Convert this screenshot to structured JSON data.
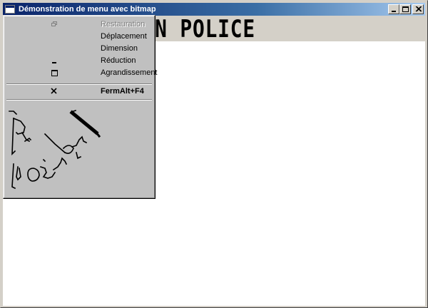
{
  "window": {
    "title": "Démonstration de menu avec bitmap",
    "buttons": {
      "minimize": "minimize-icon",
      "maximize": "maximize-icon",
      "close": "close-icon"
    }
  },
  "client": {
    "banner_text": "ON POLICE"
  },
  "menu": {
    "items": [
      {
        "label": "Restauration",
        "enabled": false,
        "icon": "restore-icon"
      },
      {
        "label": "Déplacement",
        "enabled": true,
        "icon": ""
      },
      {
        "label": "Dimension",
        "enabled": true,
        "icon": ""
      },
      {
        "label": "Réduction",
        "enabled": true,
        "icon": "minimize-icon"
      },
      {
        "label": "Agrandissement",
        "enabled": true,
        "icon": "maximize-icon"
      },
      {
        "label": "FermAlt+F4",
        "enabled": true,
        "icon": "close-icon"
      }
    ],
    "bitmap_label": "handwritten-signature-bitmap"
  },
  "colors": {
    "titlebar_start": "#0a246a",
    "titlebar_end": "#a6caf0",
    "menu_bg": "#c0c0c0",
    "window_bg": "#d4d0c8"
  }
}
